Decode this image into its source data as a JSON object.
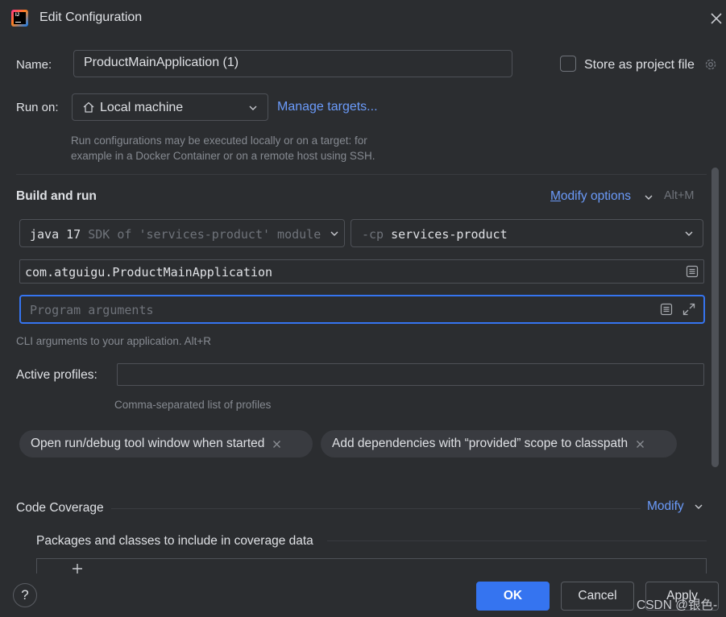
{
  "window": {
    "title": "Edit Configuration"
  },
  "name": {
    "label": "Name:",
    "value": "ProductMainApplication (1)"
  },
  "store": {
    "label": "Store as project file",
    "checked": false
  },
  "run_on": {
    "label": "Run on:",
    "value": "Local machine",
    "manage_targets": "Manage targets...",
    "help": "Run configurations may be executed locally or on a target: for example in a Docker Container or on a remote host using SSH."
  },
  "build_run": {
    "title": "Build and run",
    "modify_options": "Modify options",
    "modify_shortcut": "Alt+M",
    "sdk": {
      "bold": "java 17",
      "dim": " SDK of 'services-product' module"
    },
    "classpath": {
      "dim": "-cp ",
      "bold": "services-product"
    },
    "main_class": "com.atguigu.ProductMainApplication",
    "program_args_placeholder": "Program arguments",
    "program_args_help": "CLI arguments to your application. Alt+R",
    "profiles_label": "Active profiles:",
    "profiles_help": "Comma-separated list of profiles",
    "chips": [
      "Open run/debug tool window when started",
      "Add dependencies with “provided” scope to classpath"
    ]
  },
  "coverage": {
    "title": "Code Coverage",
    "modify": "Modify",
    "packages_title": "Packages and classes to include in coverage data"
  },
  "footer": {
    "help": "?",
    "ok": "OK",
    "cancel": "Cancel",
    "apply": "Apply",
    "watermark": "CSDN @银色-"
  },
  "colors": {
    "accent": "#3574f0",
    "link": "#6b9bfa",
    "background": "#2b2d30"
  }
}
